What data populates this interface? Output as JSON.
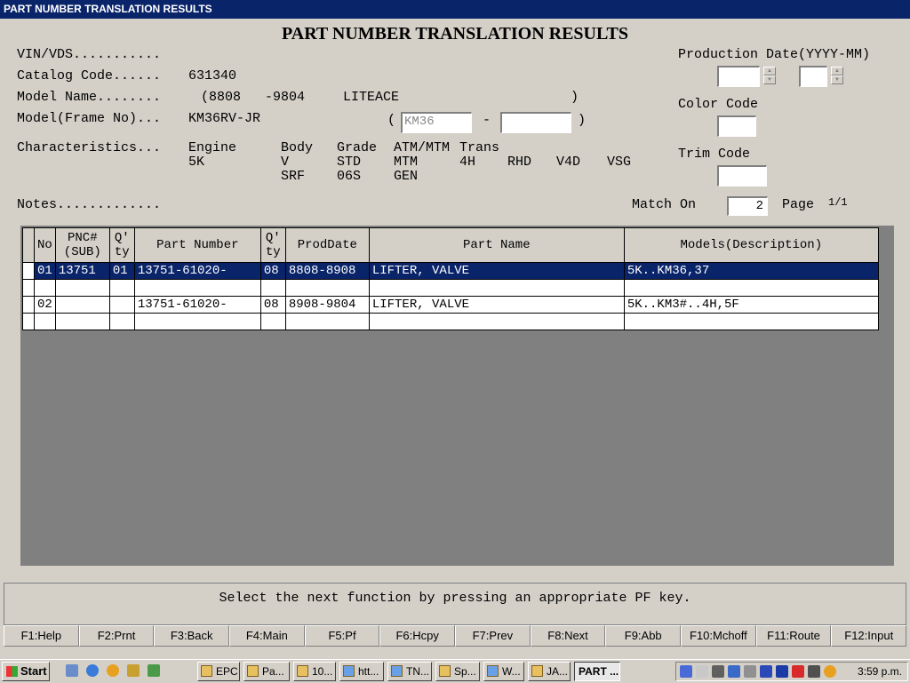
{
  "window": {
    "title": "PART NUMBER TRANSLATION RESULTS"
  },
  "heading": "PART NUMBER TRANSLATION RESULTS",
  "labels": {
    "vin": "VIN/VDS...........",
    "catalog": "Catalog Code......",
    "model_name": "Model Name........",
    "model_frame": "Model(Frame No)...",
    "characteristics": "Characteristics...",
    "notes": "Notes.............",
    "production_date": "Production Date(YYYY-MM)",
    "color_code": "Color Code",
    "trim_code": "Trim Code",
    "match_on": "Match On",
    "page": "Page"
  },
  "values": {
    "catalog_code": "631340",
    "model_name_from": "(8808",
    "model_name_to": "-9804",
    "model_name_text": "LITEACE",
    "model_name_close": ")",
    "frame_no": "KM36RV-JR",
    "frame_open": "(",
    "frame_input1": "KM36",
    "frame_dash": "-",
    "frame_close": ")",
    "match_on": "2",
    "page": "1/1"
  },
  "characteristics": {
    "headers": [
      "Engine",
      "Body",
      "Grade",
      "ATM/MTM",
      "Trans"
    ],
    "row1": [
      "5K",
      "V",
      "STD",
      "MTM",
      "4H",
      "RHD",
      "V4D",
      "VSG"
    ],
    "row2": [
      "SRF",
      "06S",
      "GEN"
    ]
  },
  "table": {
    "columns": [
      "No",
      "PNC#\n(SUB)",
      "Q'\nty",
      "Part Number",
      "Q'\nty",
      "ProdDate",
      "Part Name",
      "Models(Description)"
    ],
    "rows": [
      {
        "no": "01",
        "pnc": "13751",
        "qty1": "01",
        "part_number": "13751-61020-",
        "qty2": "08",
        "prod_date": "8808-8908",
        "part_name": "LIFTER, VALVE",
        "models": "5K..KM36,37",
        "selected": true
      },
      {
        "no": "",
        "pnc": "",
        "qty1": "",
        "part_number": "",
        "qty2": "",
        "prod_date": "",
        "part_name": "",
        "models": ""
      },
      {
        "no": "02",
        "pnc": "",
        "qty1": "",
        "part_number": "13751-61020-",
        "qty2": "08",
        "prod_date": "8908-9804",
        "part_name": "LIFTER, VALVE",
        "models": "5K..KM3#..4H,5F"
      },
      {
        "no": "",
        "pnc": "",
        "qty1": "",
        "part_number": "",
        "qty2": "",
        "prod_date": "",
        "part_name": "",
        "models": ""
      }
    ]
  },
  "message": "Select the next function by pressing an appropriate PF key.",
  "fkeys": [
    "F1:Help",
    "F2:Prnt",
    "F3:Back",
    "F4:Main",
    "F5:Pf",
    "F6:Hcpy",
    "F7:Prev",
    "F8:Next",
    "F9:Abb",
    "F10:Mchoff",
    "F11:Route",
    "F12:Input"
  ],
  "taskbar": {
    "start": "Start",
    "tasks": [
      "EPC",
      "Pa...",
      "10...",
      "htt...",
      "TN...",
      "Sp...",
      "W...",
      "JA...",
      "PART ..."
    ],
    "clock": "3:59 p.m."
  }
}
